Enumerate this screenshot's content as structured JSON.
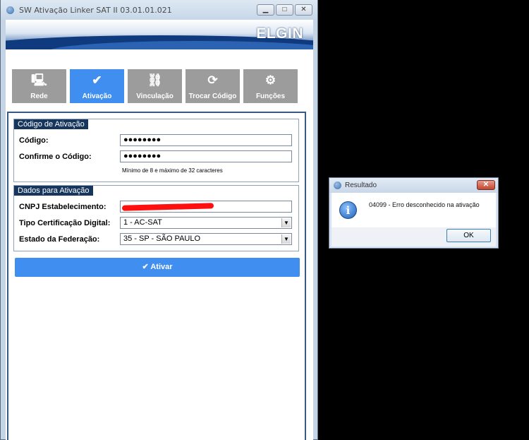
{
  "window": {
    "title": "SW Ativação Linker SAT II 03.01.01.021",
    "minimize": "▁",
    "maximize": "□",
    "close": "✕",
    "brand": "ELGIN"
  },
  "tabs": [
    {
      "label": "Rede",
      "icon": "network-icon",
      "glyph": "🖳",
      "active": false
    },
    {
      "label": "Ativação",
      "icon": "check-icon",
      "glyph": "✔",
      "active": true
    },
    {
      "label": "Vinculação",
      "icon": "link-icon",
      "glyph": "⛓",
      "active": false
    },
    {
      "label": "Trocar Código",
      "icon": "refresh-icon",
      "glyph": "⟳",
      "active": false
    },
    {
      "label": "Funções",
      "icon": "gears-icon",
      "glyph": "⚙",
      "active": false
    }
  ],
  "activation_code": {
    "title": "Código de Ativação",
    "code_label": "Código:",
    "code_value": "●●●●●●●●",
    "confirm_label": "Confirme o Código:",
    "confirm_value": "●●●●●●●●",
    "hint": "Mínimo de 8 e máximo de 32 caracteres"
  },
  "activation_data": {
    "title": "Dados para Ativação",
    "cnpj_label": "CNPJ Estabelecimento:",
    "cert_label": "Tipo Certificação Digital:",
    "cert_value": "1 - AC-SAT",
    "state_label": "Estado da Federação:",
    "state_value": "35 - SP - SÃO PAULO"
  },
  "activate_button": "✔ Ativar",
  "dialog": {
    "title": "Resultado",
    "close": "✕",
    "icon": "info-icon",
    "icon_glyph": "i",
    "message": "04099 - Erro desconhecido na ativação",
    "ok": "OK"
  },
  "colors": {
    "accent": "#3f8ef0",
    "tab_inactive": "#9c9c9c",
    "group_title": "#17365d",
    "redaction": "#ff1010"
  }
}
